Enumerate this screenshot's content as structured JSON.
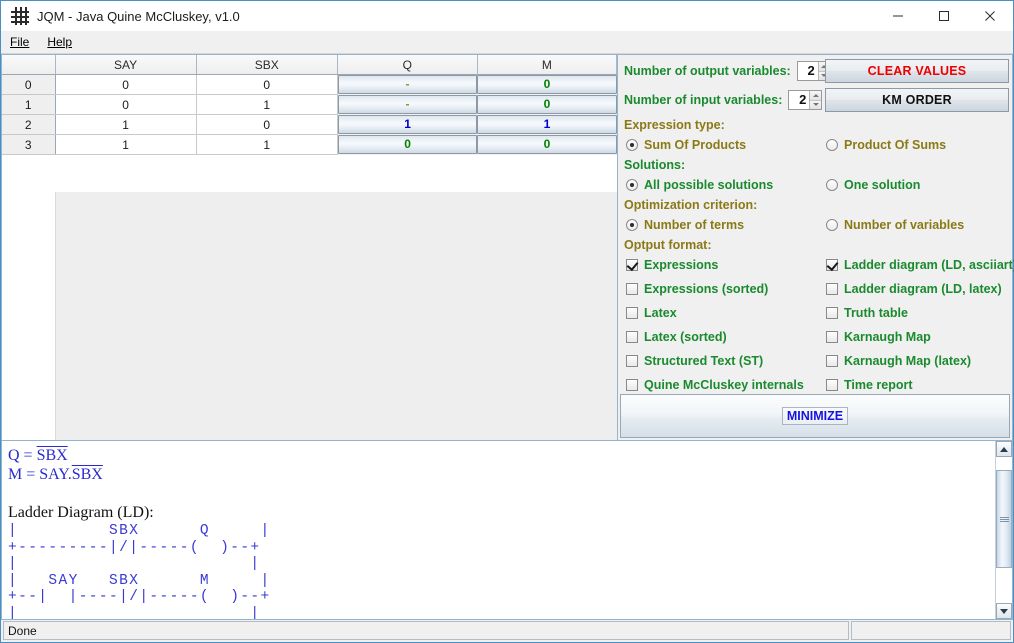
{
  "window": {
    "title": "JQM - Java Quine McCluskey, v1.0",
    "icon": "grid-icon",
    "minimize_label": "—",
    "maximize_label": "□",
    "close_label": "✕"
  },
  "menu": {
    "items": [
      {
        "label": "File"
      },
      {
        "label": "Help"
      }
    ]
  },
  "truth_table": {
    "row_header_blank": "",
    "columns": [
      "SAY",
      "SBX",
      "Q",
      "M"
    ],
    "input_columns": 2,
    "rows": [
      {
        "index": "0",
        "inputs": [
          "0",
          "0"
        ],
        "outputs": [
          "-",
          "0"
        ],
        "output_kinds": [
          "dash",
          "green"
        ]
      },
      {
        "index": "1",
        "inputs": [
          "0",
          "1"
        ],
        "outputs": [
          "-",
          "0"
        ],
        "output_kinds": [
          "dash",
          "green"
        ]
      },
      {
        "index": "2",
        "inputs": [
          "1",
          "0"
        ],
        "outputs": [
          "1",
          "1"
        ],
        "output_kinds": [
          "blue",
          "blue"
        ]
      },
      {
        "index": "3",
        "inputs": [
          "1",
          "1"
        ],
        "outputs": [
          "0",
          "0"
        ],
        "output_kinds": [
          "green",
          "green"
        ]
      }
    ]
  },
  "controls": {
    "output_vars": {
      "label": "Number of output variables:",
      "value": "2"
    },
    "input_vars": {
      "label": "Number  of  input  variables:",
      "value": "2"
    },
    "clear_button": "CLEAR VALUES",
    "km_order_button": "KM ORDER",
    "expression_type": {
      "group_label": "Expression type:",
      "options": [
        {
          "label": "Sum Of Products",
          "selected": true
        },
        {
          "label": "Product Of Sums",
          "selected": false
        }
      ]
    },
    "solutions": {
      "group_label": "Solutions:",
      "options": [
        {
          "label": "All possible solutions",
          "selected": true
        },
        {
          "label": "One solution",
          "selected": false
        }
      ]
    },
    "optimization": {
      "group_label": "Optimization criterion:",
      "options": [
        {
          "label": "Number of terms",
          "selected": true
        },
        {
          "label": "Number of variables",
          "selected": false
        }
      ]
    },
    "output_format": {
      "group_label": "Optput format:",
      "left": [
        {
          "label": "Expressions",
          "checked": true
        },
        {
          "label": "Expressions (sorted)",
          "checked": false
        },
        {
          "label": "Latex",
          "checked": false
        },
        {
          "label": "Latex (sorted)",
          "checked": false
        },
        {
          "label": "Structured Text (ST)",
          "checked": false
        },
        {
          "label": "Quine McCluskey internals",
          "checked": false
        }
      ],
      "right": [
        {
          "label": "Ladder diagram (LD, asciiart)",
          "checked": true
        },
        {
          "label": "Ladder diagram (LD, latex)",
          "checked": false
        },
        {
          "label": "Truth table",
          "checked": false
        },
        {
          "label": "Karnaugh Map",
          "checked": false
        },
        {
          "label": "Karnaugh Map (latex)",
          "checked": false
        },
        {
          "label": "Time report",
          "checked": false
        }
      ]
    },
    "minimize_button": "MINIMIZE"
  },
  "output": {
    "expr_q_lhs": "Q = ",
    "expr_q_rhs": "SBX",
    "expr_m_lhs": "M = SAY.",
    "expr_m_rhs": "SBX",
    "ladder_title": "Ladder Diagram (LD):",
    "ladder_art": "|         SBX      Q     |\n+---------|/|-----(  )--+\n|                       |\n|   SAY   SBX      M     |\n+--|  |----|/|-----(  )--+\n|                       |"
  },
  "status": {
    "message": "Done",
    "side_panel": ""
  },
  "colors": {
    "label_green": "#1a8a2e",
    "label_olive": "#8a7a16",
    "value_blue": "#0000d0",
    "value_green": "#008000",
    "clear_red": "#ee0000",
    "minimize_blue": "#1414e0",
    "expression_blue": "#2a2ad0"
  }
}
